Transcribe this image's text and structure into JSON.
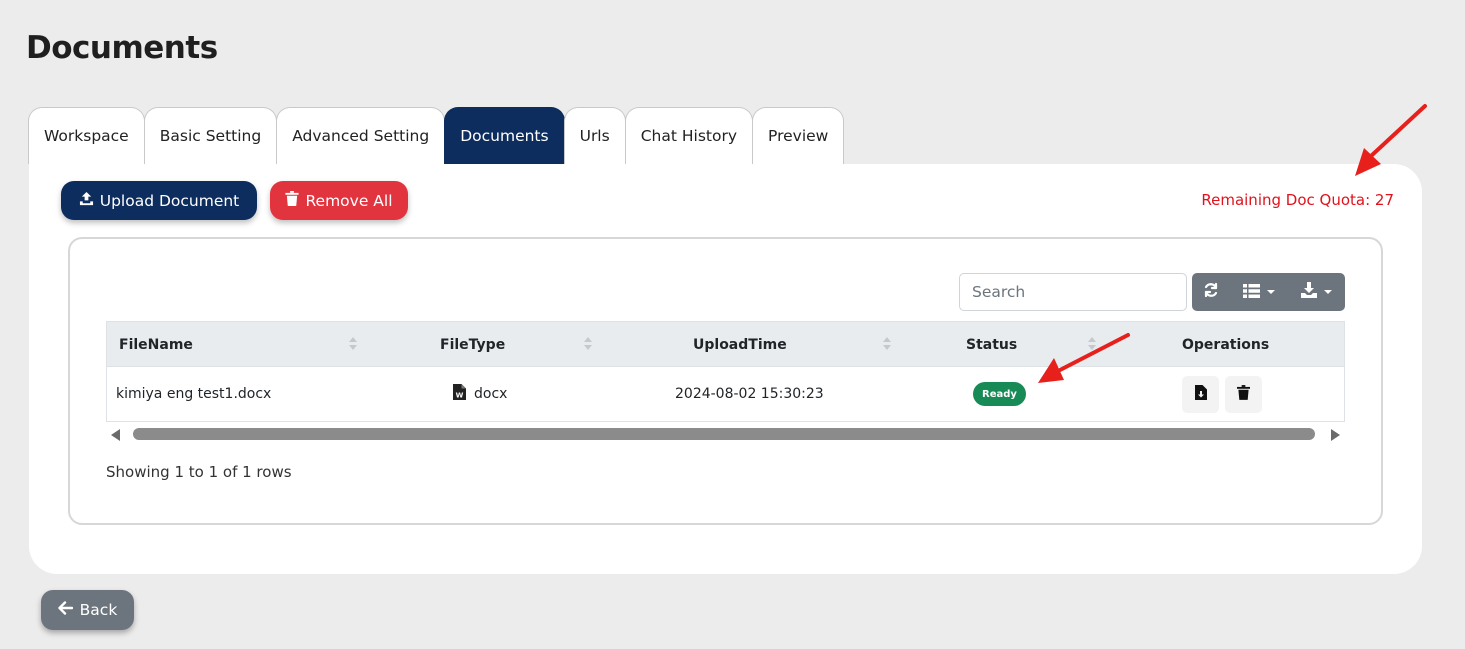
{
  "page": {
    "title": "Documents"
  },
  "tabs": [
    {
      "label": "Workspace",
      "active": false
    },
    {
      "label": "Basic Setting",
      "active": false
    },
    {
      "label": "Advanced Setting",
      "active": false
    },
    {
      "label": "Documents",
      "active": true
    },
    {
      "label": "Urls",
      "active": false
    },
    {
      "label": "Chat History",
      "active": false
    },
    {
      "label": "Preview",
      "active": false
    }
  ],
  "actions": {
    "upload_label": "Upload Document",
    "remove_all_label": "Remove All",
    "quota_text": "Remaining Doc Quota: 27"
  },
  "table": {
    "search_placeholder": "Search",
    "toolbar_icons": [
      "refresh-icon",
      "columns-icon",
      "export-icon"
    ],
    "columns": [
      "FileName",
      "FileType",
      "UploadTime",
      "Status",
      "Operations"
    ],
    "rows": [
      {
        "filename": "kimiya eng test1.docx",
        "filetype": "docx",
        "upload_time": "2024-08-02 15:30:23",
        "status": "Ready"
      }
    ],
    "footer": "Showing 1 to 1 of 1 rows"
  },
  "footer": {
    "back_label": "Back"
  },
  "colors": {
    "primary": "#0d2d5e",
    "danger": "#e1343f",
    "quota": "#e0121c",
    "status_ready": "#178a55",
    "secondary": "#6c757d",
    "annotation": "#e8201c"
  }
}
